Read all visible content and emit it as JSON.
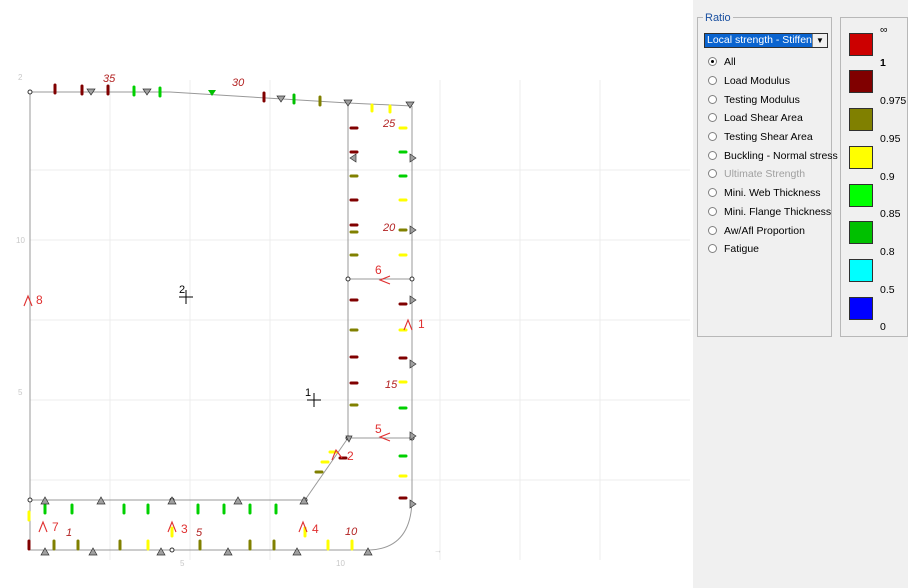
{
  "canvas": {
    "stiffener_labels": [
      "35",
      "30",
      "25",
      "20",
      "15",
      "10",
      "5",
      "1"
    ],
    "panel_labels": [
      "8",
      "7",
      "6",
      "5",
      "4",
      "3",
      "2",
      "1"
    ],
    "node_labels": [
      "2",
      "1"
    ]
  },
  "ratio": {
    "group_title": "Ratio",
    "selected": "Local strength - Stiffener",
    "options": [
      {
        "label": "All",
        "checked": true,
        "enabled": true
      },
      {
        "label": "Load Modulus",
        "checked": false,
        "enabled": true
      },
      {
        "label": "Testing Modulus",
        "checked": false,
        "enabled": true
      },
      {
        "label": "Load Shear Area",
        "checked": false,
        "enabled": true
      },
      {
        "label": "Testing Shear Area",
        "checked": false,
        "enabled": true
      },
      {
        "label": "Buckling - Normal stress",
        "checked": false,
        "enabled": true
      },
      {
        "label": "Ultimate Strength",
        "checked": false,
        "enabled": false
      },
      {
        "label": "Mini. Web Thickness",
        "checked": false,
        "enabled": true
      },
      {
        "label": "Mini. Flange Thickness",
        "checked": false,
        "enabled": true
      },
      {
        "label": "Aw/Afl Proportion",
        "checked": false,
        "enabled": true
      },
      {
        "label": "Fatigue",
        "checked": false,
        "enabled": true
      }
    ]
  },
  "legend": {
    "levels": [
      "∞",
      "1",
      "0.975",
      "0.95",
      "0.9",
      "0.85",
      "0.8",
      "0.5",
      "0"
    ],
    "colors": [
      "#cc0000",
      "#800000",
      "#808000",
      "#ffff00",
      "#00ff00",
      "#00c000",
      "#00ffff",
      "#0000ff"
    ]
  }
}
